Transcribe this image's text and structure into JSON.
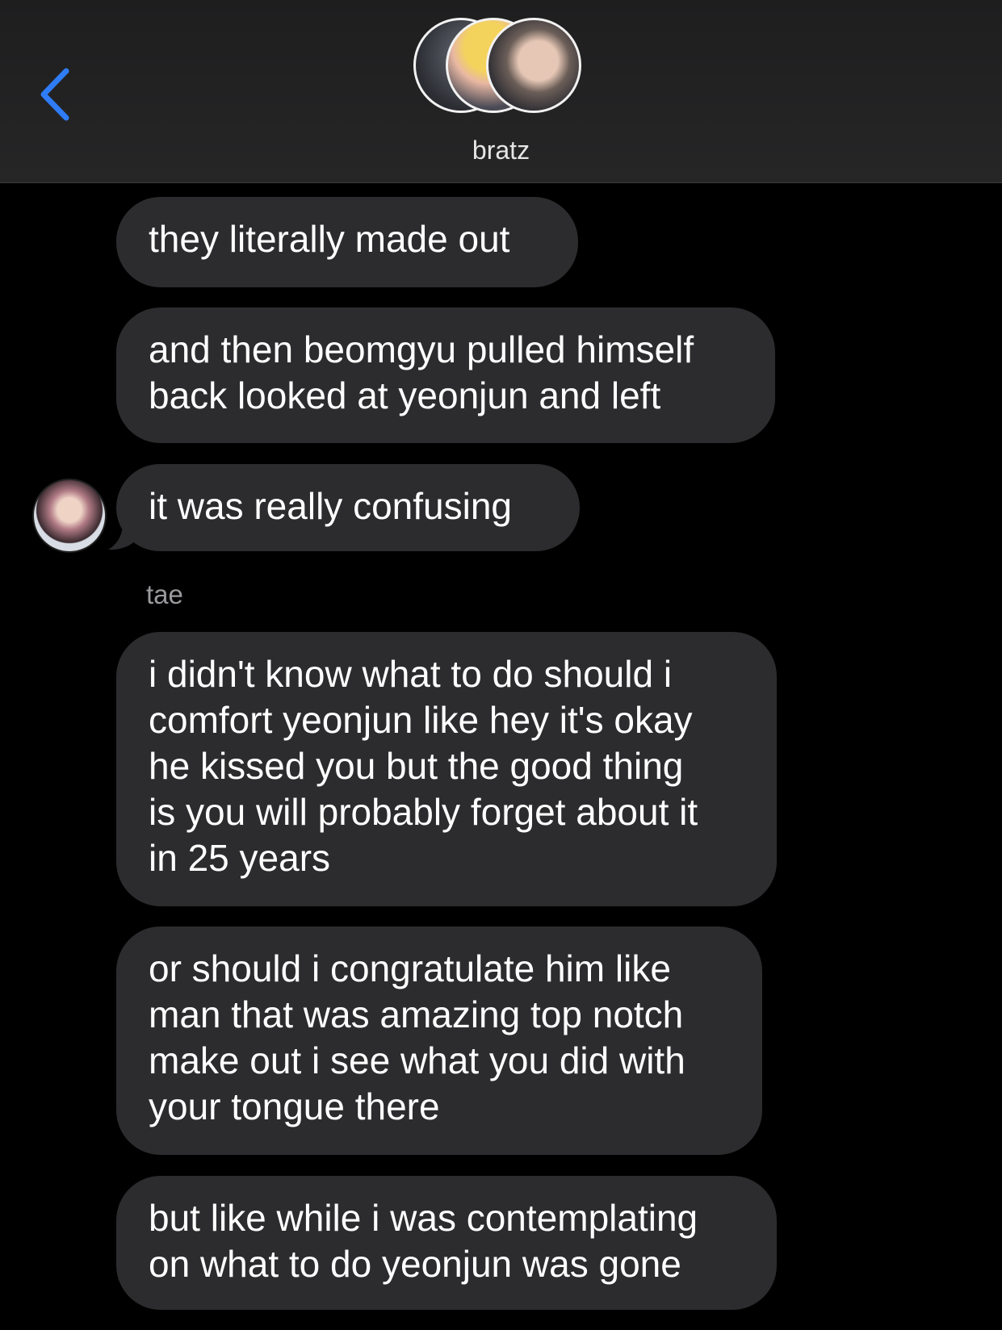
{
  "header": {
    "title": "bratz"
  },
  "messages": [
    {
      "text": "they literally made out"
    },
    {
      "text": "and then beomgyu pulled himself\nback looked at yeonjun and left"
    },
    {
      "text": "it was really confusing"
    },
    {
      "text": "i didn't know what to do should i\ncomfort yeonjun like hey it's okay\nhe kissed you but the good thing\nis you will probably forget about it\nin 25 years"
    },
    {
      "text": "or should i congratulate him like\nman that was amazing top notch\nmake out i see what you did with\nyour tongue there"
    },
    {
      "text": "but like while i was contemplating\non what to do yeonjun was gone"
    }
  ],
  "sender": {
    "name": "tae"
  },
  "colors": {
    "background": "#000000",
    "bubble": "#2c2c2e",
    "accent": "#2f7cf6",
    "secondary_text": "#9a9a9e"
  }
}
